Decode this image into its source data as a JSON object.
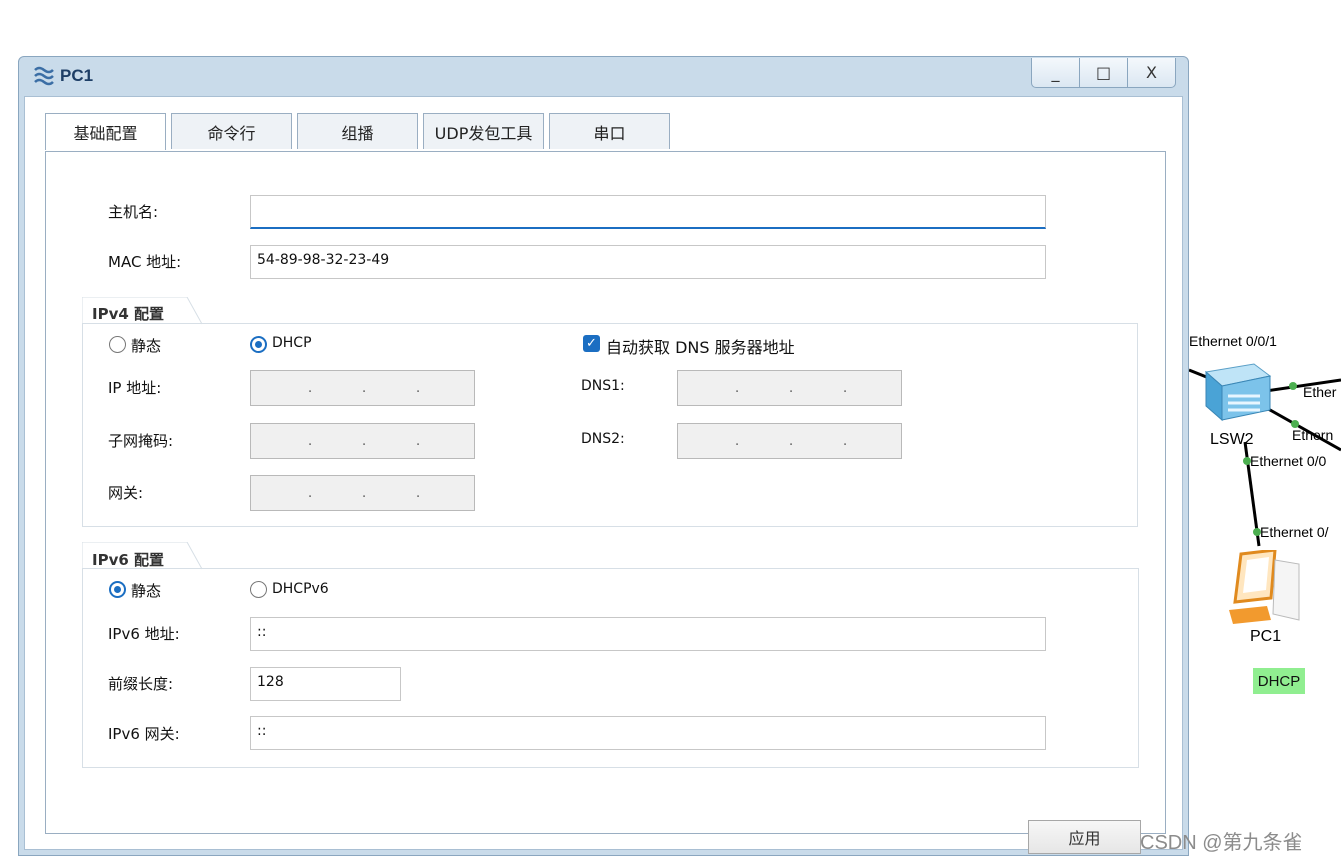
{
  "window": {
    "title": "PC1",
    "minimize": "_",
    "maximize": "□",
    "close": "X"
  },
  "tabs": [
    "基础配置",
    "命令行",
    "组播",
    "UDP发包工具",
    "串口"
  ],
  "basic": {
    "hostname_label": "主机名:",
    "hostname_value": "",
    "mac_label": "MAC 地址:",
    "mac_value": "54-89-98-32-23-49"
  },
  "ipv4": {
    "group_title": "IPv4 配置",
    "static_label": "静态",
    "dhcp_label": "DHCP",
    "selected": "DHCP",
    "auto_dns_label": "自动获取 DNS 服务器地址",
    "auto_dns_checked": true,
    "ip_label": "IP 地址:",
    "mask_label": "子网掩码:",
    "gateway_label": "网关:",
    "dns1_label": "DNS1:",
    "dns2_label": "DNS2:",
    "dot": "."
  },
  "ipv6": {
    "group_title": "IPv6 配置",
    "static_label": "静态",
    "dhcpv6_label": "DHCPv6",
    "selected": "静态",
    "addr_label": "IPv6 地址:",
    "addr_value": "::",
    "prefix_label": "前缀长度:",
    "prefix_value": "128",
    "gateway_label": "IPv6 网关:",
    "gateway_value": "::"
  },
  "apply_label": "应用",
  "topology": {
    "switch_name": "LSW2",
    "pc_name": "PC1",
    "pc_badge": "DHCP",
    "port_labels": [
      "Ethernet 0/0/1",
      "Ether",
      "Ethern",
      "Ethernet 0/0",
      "Ethernet 0/"
    ]
  },
  "colors": {
    "accent": "#1b6ec2",
    "window_frame": "#c9dbea",
    "badge_green": "#90ee90"
  },
  "watermark": "CSDN @第九条雀"
}
